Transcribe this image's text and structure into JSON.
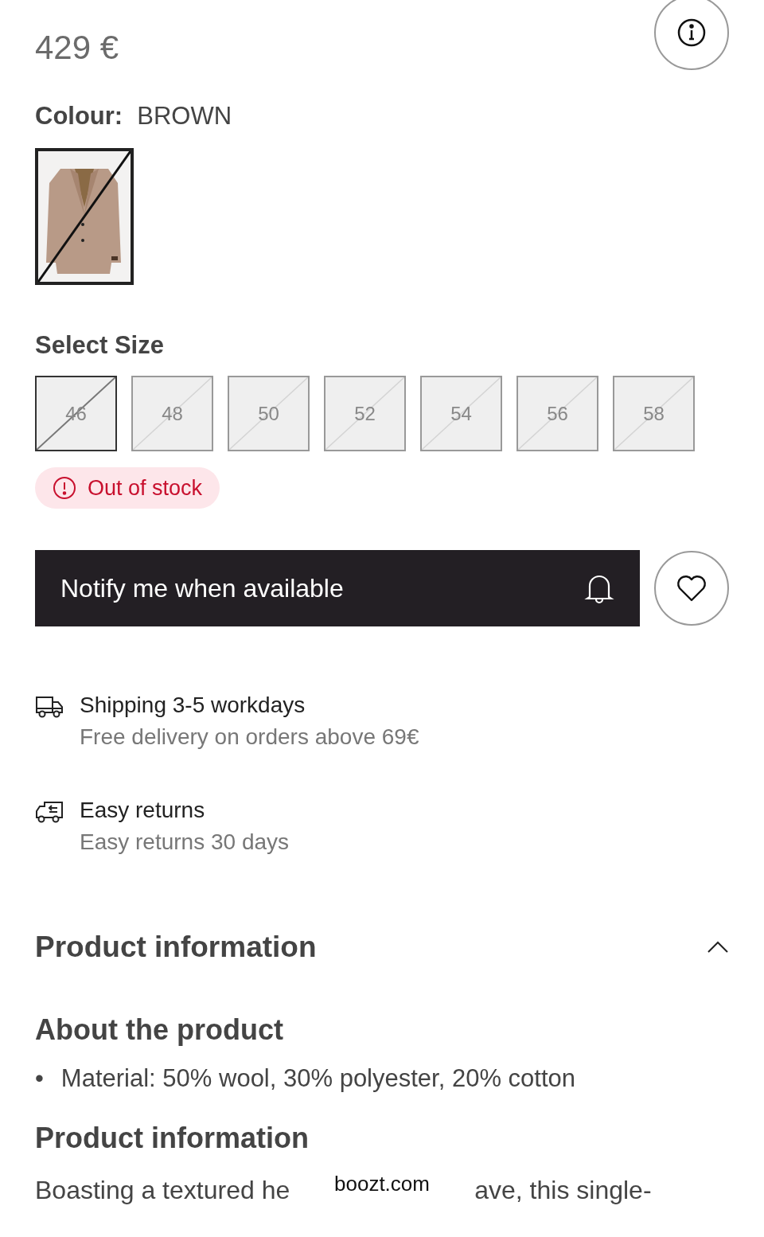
{
  "price": "429 €",
  "colour": {
    "label": "Colour:",
    "value": "BROWN",
    "swatches": [
      {
        "kind": "picture",
        "selected": true,
        "available": false
      }
    ]
  },
  "size_picker": {
    "title": "Select Size",
    "sizes": [
      {
        "label": "46",
        "selected": true,
        "available": false
      },
      {
        "label": "48",
        "selected": false,
        "available": false
      },
      {
        "label": "50",
        "selected": false,
        "available": false
      },
      {
        "label": "52",
        "selected": false,
        "available": false
      },
      {
        "label": "54",
        "selected": false,
        "available": false
      },
      {
        "label": "56",
        "selected": false,
        "available": false
      },
      {
        "label": "58",
        "selected": false,
        "available": false
      }
    ]
  },
  "stock_badge": "Out of stock",
  "notify_button": "Notify me when available",
  "delivery": [
    {
      "kind": "shipping",
      "title": "Shipping 3-5 workdays",
      "subtitle": "Free delivery on orders above 69€"
    },
    {
      "kind": "returns",
      "title": "Easy returns",
      "subtitle": "Easy returns 30 days"
    }
  ],
  "product_info": {
    "title": "Product information",
    "expanded": true,
    "about_title": "About the product",
    "bullets": [
      {
        "marker": "•",
        "text": "Material: 50% wool, 30% polyester, 20% cotton"
      }
    ],
    "description_title": "Product information",
    "description_parts": [
      "Boasting a textured he",
      "ave, this single-"
    ]
  },
  "url_bar": "boozt.com"
}
